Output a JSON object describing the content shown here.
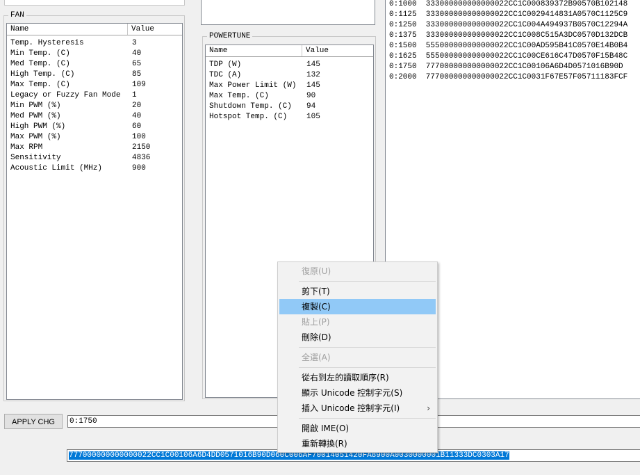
{
  "fan": {
    "title": "FAN",
    "columns": [
      "Name",
      "Value"
    ],
    "rows": [
      {
        "name": "Temp. Hysteresis",
        "value": "3"
      },
      {
        "name": "Min Temp. (C)",
        "value": "40"
      },
      {
        "name": "Med Temp. (C)",
        "value": "65"
      },
      {
        "name": "High Temp. (C)",
        "value": "85"
      },
      {
        "name": "Max Temp. (C)",
        "value": "109"
      },
      {
        "name": "Legacy or Fuzzy Fan Mode",
        "value": "1"
      },
      {
        "name": "Min PWM (%)",
        "value": "20"
      },
      {
        "name": "Med PWM (%)",
        "value": "40"
      },
      {
        "name": "High PWM (%)",
        "value": "60"
      },
      {
        "name": "Max PWM (%)",
        "value": "100"
      },
      {
        "name": "Max RPM",
        "value": "2150"
      },
      {
        "name": "Sensitivity",
        "value": "4836"
      },
      {
        "name": "Acoustic Limit (MHz)",
        "value": "900"
      }
    ]
  },
  "powertune": {
    "title": "POWERTUNE",
    "columns": [
      "Name",
      "Value"
    ],
    "rows": [
      {
        "name": "TDP (W)",
        "value": "145"
      },
      {
        "name": "TDC (A)",
        "value": "132"
      },
      {
        "name": "Max Power Limit (W)",
        "value": "145"
      },
      {
        "name": "Max Temp. (C)",
        "value": "90"
      },
      {
        "name": "Shutdown Temp. (C)",
        "value": "94"
      },
      {
        "name": "Hotspot Temp. (C)",
        "value": "105"
      }
    ]
  },
  "hex_list": [
    "0:1000  333000000000000022CC1C000839372B90570B102148",
    "0:1125  333000000000000022CC1C0029414831A0570C1125C9",
    "0:1250  333000000000000022CC1C004A494937B0570C12294A",
    "0:1375  333000000000000022CC1C008C515A3DC0570D132DCB",
    "0:1500  555000000000000022CC1C00AD595B41C0570E14B0B4",
    "0:1625  555000000000000022CC1C00CE616C47D0570F15B48C",
    "0:1750  777000000000000022CC1C00106A6D4D0571016B90D",
    "0:2000  777000000000000022CC1C0031F67E57F05711183FCF"
  ],
  "apply_button": "APPLY CHG",
  "address_field": "0:1750",
  "hex_field": "777000000000000022CC1C00106A6D4DD0571016B90D060C006AF70014051420FA8900A0030000001B11333DC0303A17",
  "context_menu": {
    "items": [
      {
        "label": "復原(U)",
        "disabled": true
      },
      {
        "label": "剪下(T)",
        "disabled": false
      },
      {
        "label": "複製(C)",
        "disabled": false,
        "hover": true
      },
      {
        "label": "貼上(P)",
        "disabled": true
      },
      {
        "label": "刪除(D)",
        "disabled": false
      },
      {
        "label": "全選(A)",
        "disabled": true
      },
      {
        "label": "從右到左的讀取順序(R)",
        "disabled": false
      },
      {
        "label": "顯示 Unicode 控制字元(S)",
        "disabled": false
      },
      {
        "label": "插入 Unicode 控制字元(I)",
        "disabled": false,
        "submenu": true
      },
      {
        "label": "開啟 IME(O)",
        "disabled": false
      },
      {
        "label": "重新轉換(R)",
        "disabled": false
      }
    ]
  },
  "colors": {
    "selection": "#0078d7",
    "menu_hover": "#91c9f7"
  }
}
